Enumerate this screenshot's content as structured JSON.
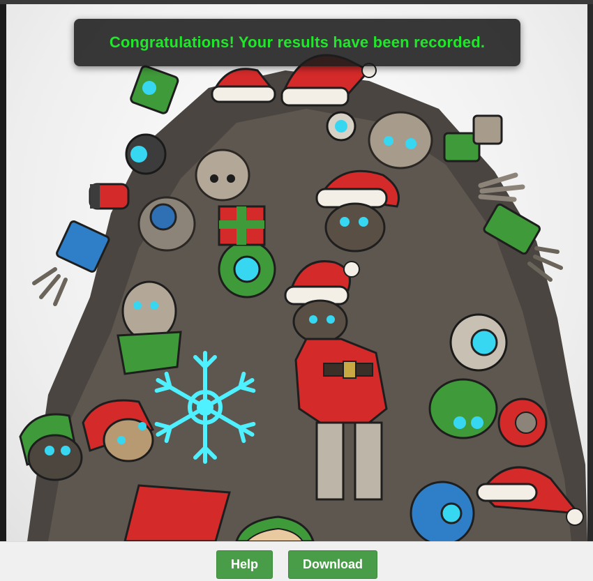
{
  "notification": {
    "message": "Congratulations! Your results have been recorded.",
    "text_color": "#22e62c"
  },
  "scene": {
    "description_icon": "robot-pile-illustration",
    "snowflake_icon": "snowflake-icon",
    "colors": {
      "santa_red": "#d42a2a",
      "robot_green": "#3f9a3a",
      "eye_cyan": "#37d7f2",
      "metal": "#8c8478"
    }
  },
  "footer": {
    "help_label": "Help",
    "download_label": "Download",
    "button_color": "#4a9d48"
  }
}
